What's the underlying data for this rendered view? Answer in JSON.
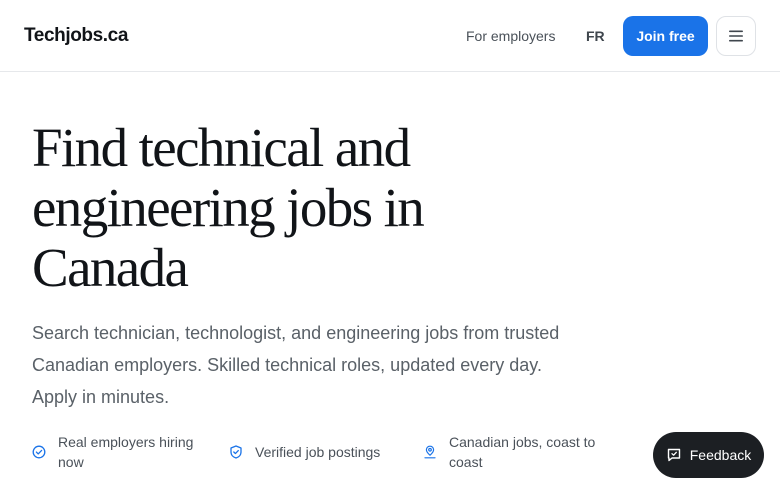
{
  "header": {
    "logo": "Techjobs.ca",
    "for_employers": "For employers",
    "language": "FR",
    "join_label": "Join free",
    "menu_icon": "hamburger-menu-icon"
  },
  "hero": {
    "headline": "Find technical and engineering jobs in Canada",
    "subtitle": "Search technician, technologist, and engineering jobs from trusted Canadian employers. Skilled technical roles, updated every day. Apply in minutes."
  },
  "features": [
    {
      "icon": "check-circle-icon",
      "label": "Real employers hiring now"
    },
    {
      "icon": "shield-check-icon",
      "label": "Verified job postings"
    },
    {
      "icon": "map-pin-icon",
      "label": "Canadian jobs, coast to coast"
    }
  ],
  "feedback": {
    "label": "Feedback",
    "icon": "feedback-chat-icon"
  },
  "colors": {
    "primary": "#1a73e8",
    "feature_icon": "#1a73e8",
    "feedback_bg": "#1c1f23"
  }
}
